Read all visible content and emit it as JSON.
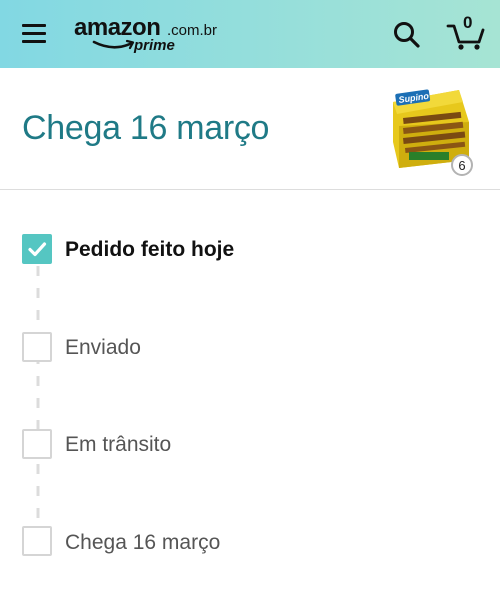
{
  "header": {
    "logo_word": "amazon",
    "logo_suffix": ".com.br",
    "logo_prime": "prime",
    "cart_count": "0",
    "icons": {
      "menu": "hamburger-menu-icon",
      "search": "search-icon",
      "cart": "cart-icon",
      "check": "checkmark-icon"
    }
  },
  "order": {
    "arrival_title": "Chega 16 março",
    "product_quantity": "6",
    "product_brand": "Supino"
  },
  "tracker": {
    "steps": [
      {
        "label": "Pedido feito hoje",
        "done": true
      },
      {
        "label": "Enviado",
        "done": false
      },
      {
        "label": "Em trânsito",
        "done": false
      },
      {
        "label": "Chega 16 março",
        "done": false
      }
    ]
  },
  "colors": {
    "header_gradient_start": "#82d8e3",
    "header_gradient_end": "#a6e4d4",
    "title_teal": "#1f7a86",
    "check_fill": "#55c6c2",
    "inactive_border": "#d5d5d5"
  }
}
